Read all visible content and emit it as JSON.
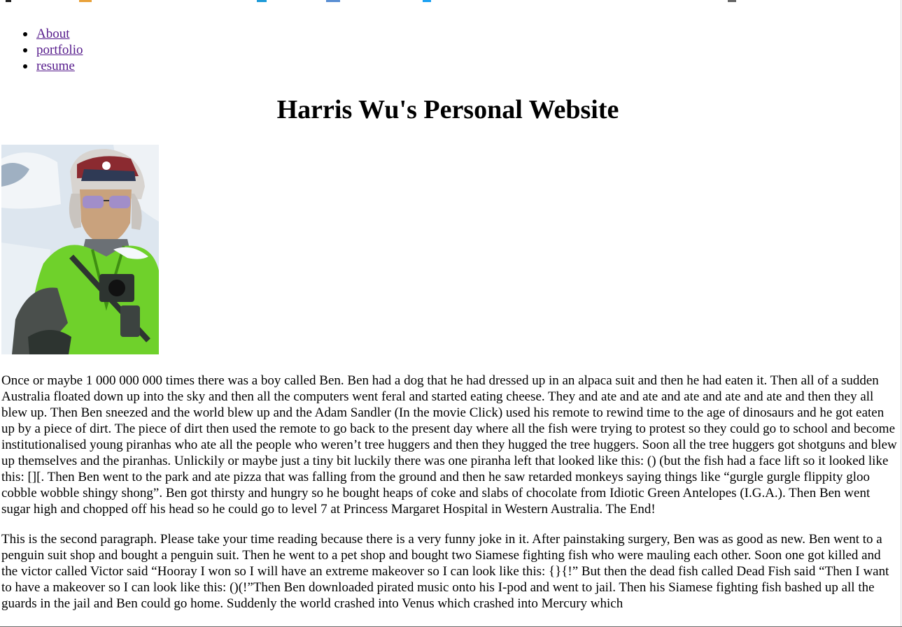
{
  "nav": {
    "items": [
      {
        "label": "About"
      },
      {
        "label": "portfolio"
      },
      {
        "label": "resume"
      }
    ]
  },
  "header": {
    "title": "Harris Wu's Personal Website"
  },
  "photo": {
    "colors": {
      "jacket": "#6fd12b",
      "snow": "#e9eff5",
      "hat": "#8b2a30",
      "skin": "#c9a27d",
      "dark": "#2d3430"
    }
  },
  "main": {
    "paragraphs": [
      "Once or maybe 1 000 000 000 times there was a boy called Ben. Ben had a dog that he had dressed up in an alpaca suit and then he had eaten it. Then all of a sudden Australia floated down up into the sky and then all the computers went feral and started eating cheese. They and ate and ate and ate and ate and ate and then they all blew up. Then Ben sneezed and the world blew up and the Adam Sandler (In the movie Click) used his remote to rewind time to the age of dinosaurs and he got eaten up by a piece of dirt. The piece of dirt then used the remote to go back to the present day where all the fish were trying to protest so they could go to school and become institutionalised young piranhas who ate all the people who weren’t tree huggers and then they hugged the tree huggers. Soon all the tree huggers got shotguns and blew up themselves and the piranhas. Unlickily or maybe just a tiny bit luckily there was one piranha left that looked like this: () (but the fish had a face lift so it looked like this: [][. Then Ben went to the park and ate pizza that was falling from the ground and then he saw retarded monkeys saying things like “gurgle gurgle flippity gloo cobble wobble shingy shong”. Ben got thirsty and hungry so he bought heaps of coke and slabs of chocolate from Idiotic Green Antelopes (I.G.A.). Then Ben went sugar high and chopped off his head so he could go to level 7 at Princess Margaret Hospital in Western Australia. The End!",
      "This is the second paragraph. Please take your time reading because there is a very funny joke in it. After painstaking surgery, Ben was as good as new. Ben went to a penguin suit shop and bought a penguin suit. Then he went to a pet shop and bought two Siamese fighting fish who were mauling each other. Soon one got killed and the victor called Victor said “Hooray I won so I will have an extreme makeover so I can look like this: {}{!” But then the dead fish called Dead Fish said “Then I want to have a makeover so I can look like this: ()(!”Then Ben downloaded pirated music onto his I-pod and went to jail. Then his Siamese fighting fish bashed up all the guards in the jail and Ben could go home. Suddenly the world crashed into Venus which crashed into Mercury which"
    ]
  }
}
